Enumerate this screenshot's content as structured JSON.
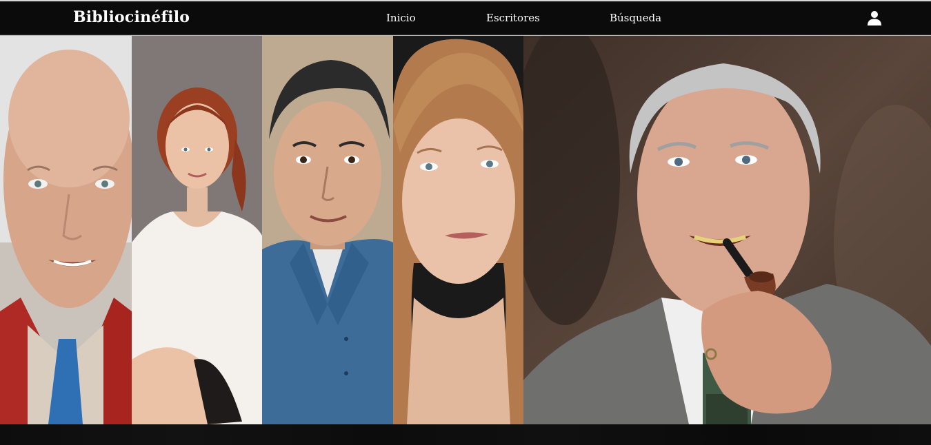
{
  "navbar": {
    "brand": "Bibliocinéfilo",
    "links": [
      {
        "label": "Inicio"
      },
      {
        "label": "Escritores"
      },
      {
        "label": "Búsqueda"
      }
    ],
    "user_icon": "user-icon"
  },
  "gallery": {
    "panels": [
      {
        "name": "bald-elderly-man-portrait",
        "bg": "#e3e3e3"
      },
      {
        "name": "red-haired-woman-portrait",
        "bg": "#7b7272"
      },
      {
        "name": "dark-haired-man-portrait",
        "bg": "#b5a28a"
      },
      {
        "name": "blonde-woman-portrait",
        "bg": "#1a1a1a"
      },
      {
        "name": "elderly-man-with-pipe-portrait",
        "bg": "#4a3a30"
      }
    ]
  },
  "colors": {
    "navbar_bg": "#0b0b0b",
    "text": "#ffffff"
  }
}
